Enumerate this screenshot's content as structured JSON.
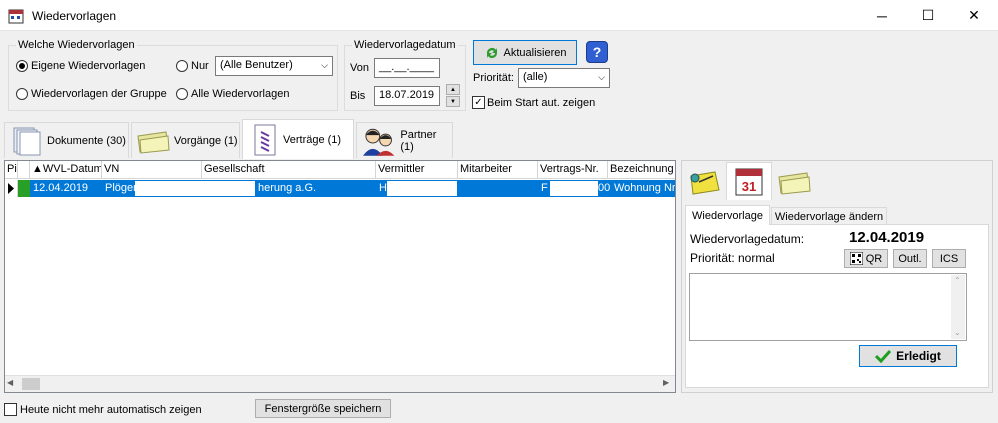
{
  "window": {
    "title": "Wiedervorlagen",
    "minimize": "─",
    "maximize": "☐",
    "close": "✕"
  },
  "filter": {
    "group_label": "Welche Wiedervorlagen",
    "own": "Eigene Wiedervorlagen",
    "only": "Nur",
    "user_select": "(Alle Benutzer)",
    "group": "Wiedervorlagen der Gruppe",
    "all": "Alle Wiedervorlagen"
  },
  "date": {
    "group_label": "Wiedervorlagedatum",
    "from_label": "Von",
    "from_value": "__.__.____",
    "to_label": "Bis",
    "to_value": "18.07.2019"
  },
  "actions": {
    "refresh": "Aktualisieren",
    "help": "?",
    "priority_label": "Priorität:",
    "priority_value": "(alle)",
    "autostart": "Beim Start aut. zeigen"
  },
  "tabs": [
    {
      "label": "Dokumente (30)"
    },
    {
      "label": "Vorgänge (1)"
    },
    {
      "label": "Verträge (1)"
    },
    {
      "label": "Partner (1)"
    }
  ],
  "grid": {
    "columns": [
      "Pi",
      "▲WVL-Datum",
      "VN",
      "Gesellschaft",
      "Vermittler",
      "Mitarbeiter",
      "Vertrags-Nr.",
      "Bezeichnung"
    ],
    "rows": [
      {
        "date": "12.04.2019",
        "vn": "Plöger",
        "gesellschaft": "herung a.G.",
        "vermittler": "H",
        "vertrag_start": "F",
        "vertrag_end": "00",
        "bezeichnung": "Wohnung Nr."
      }
    ]
  },
  "detail": {
    "tab_active": "Wiedervorlage",
    "tab_edit": "Wiedervorlage ändern",
    "date_label": "Wiedervorlagedatum:",
    "date_value": "12.04.2019",
    "priority": "Priorität: normal",
    "qr": "QR",
    "outl": "Outl.",
    "ics": "ICS",
    "done": "Erledigt"
  },
  "footer": {
    "no_auto": "Heute nicht mehr automatisch zeigen",
    "save_size": "Fenstergröße speichern"
  }
}
